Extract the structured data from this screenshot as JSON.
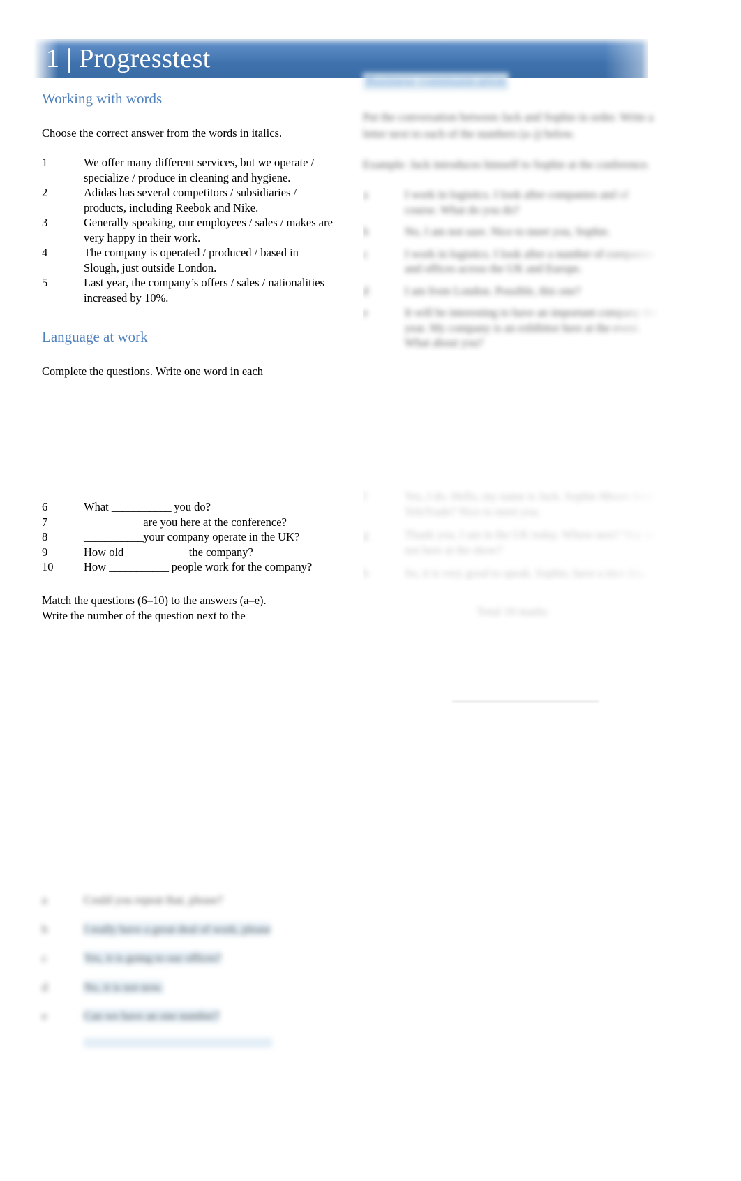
{
  "document": {
    "title": "1 | Progresstest",
    "accent_blue": "#4f81bd",
    "banner_blue": "#3f72ad",
    "highlight_blue": "#dceaf4"
  },
  "left_column": {
    "section_1": {
      "heading": "Working with words",
      "instruction": "Choose the correct answer from the words in      italics.",
      "questions": [
        {
          "num": "1",
          "text": "We offer many different services, but we operate / specialize / produce  in cleaning and hygiene."
        },
        {
          "num": "2",
          "text": "Adidas has several competitors / subsidiaries / products, including Reebok and Nike."
        },
        {
          "num": "3",
          "text": "Generally speaking, our employees / sales / makes are very happy in their work."
        },
        {
          "num": "4",
          "text": "The company is operated / produced / based in Slough, just outside London."
        },
        {
          "num": "5",
          "text": "Last year, the company’s  offers / sales / nationalities  increased by 10%."
        }
      ]
    },
    "section_2": {
      "heading": "Language at work",
      "instruction": "Complete the questions. Write one word in each",
      "questions": [
        {
          "num": "6",
          "prefix": "What ",
          "blank": "___________",
          "suffix": " you do?"
        },
        {
          "num": "7",
          "prefix": "",
          "blank": "___________",
          "suffix": "are you here at the conference?"
        },
        {
          "num": "8",
          "prefix": "",
          "blank": "___________",
          "suffix": "your company operate in the UK?"
        },
        {
          "num": "9",
          "prefix": "How old ",
          "blank": "___________",
          "suffix": " the company?"
        },
        {
          "num": "10",
          "prefix": "How ",
          "blank": "___________",
          "suffix": " people work for the company?"
        }
      ],
      "match_instruction_line1": "Match the questions (6–10) to the answers (a–e).",
      "match_instruction_line2": "Write the number of the question next to the"
    },
    "blurred_answers": [
      {
        "num": "a",
        "text": "Could you repeat that, please?",
        "highlight": false
      },
      {
        "num": "b",
        "text": "I really have a great deal of work, please",
        "highlight": true
      },
      {
        "num": "c",
        "text": "Yes, it is going to our offices?",
        "highlight": true
      },
      {
        "num": "d",
        "text": "No, it is not now.",
        "highlight": true
      },
      {
        "num": "e",
        "text": "Can we have an one number?",
        "highlight": true
      }
    ]
  },
  "right_column": {
    "blurred_heading": "Business communication",
    "blurred_paragraphs": [
      "Put the conversation between Jack and Sophie in order. Write a letter next to each of the numbers (a–j) below.",
      "Example: Jack introduces himself to Sophie at the conference."
    ],
    "blurred_list_a": [
      {
        "num": "a",
        "text": "I work in logistics. I look after companies and of course. What do you do?"
      },
      {
        "num": "b",
        "text": "No, I am not sure. Nice to meet you, Sophie."
      },
      {
        "num": "c",
        "text": "I work in logistics. I look after a number of companies and offices across the UK and Europe."
      },
      {
        "num": "d",
        "text": "I am from London. Possible, this one?"
      },
      {
        "num": "e",
        "text": "It will be interesting to have an important company this year. My company is an exhibitor here at the event. What about you?"
      }
    ],
    "blurred_list_b": [
      {
        "num": "f",
        "text": "Yes, I do. Hello, my name is Jack. Sophie Moore from TeleTrade? Nice to meet you."
      },
      {
        "num": "g",
        "text": "Thank you, I am in the UK today. Where next? You are not here at the show?"
      },
      {
        "num": "h",
        "text": "So, it is very good to speak. Sophie, have a nice day."
      }
    ],
    "blurred_total": "Total                    10 marks"
  }
}
